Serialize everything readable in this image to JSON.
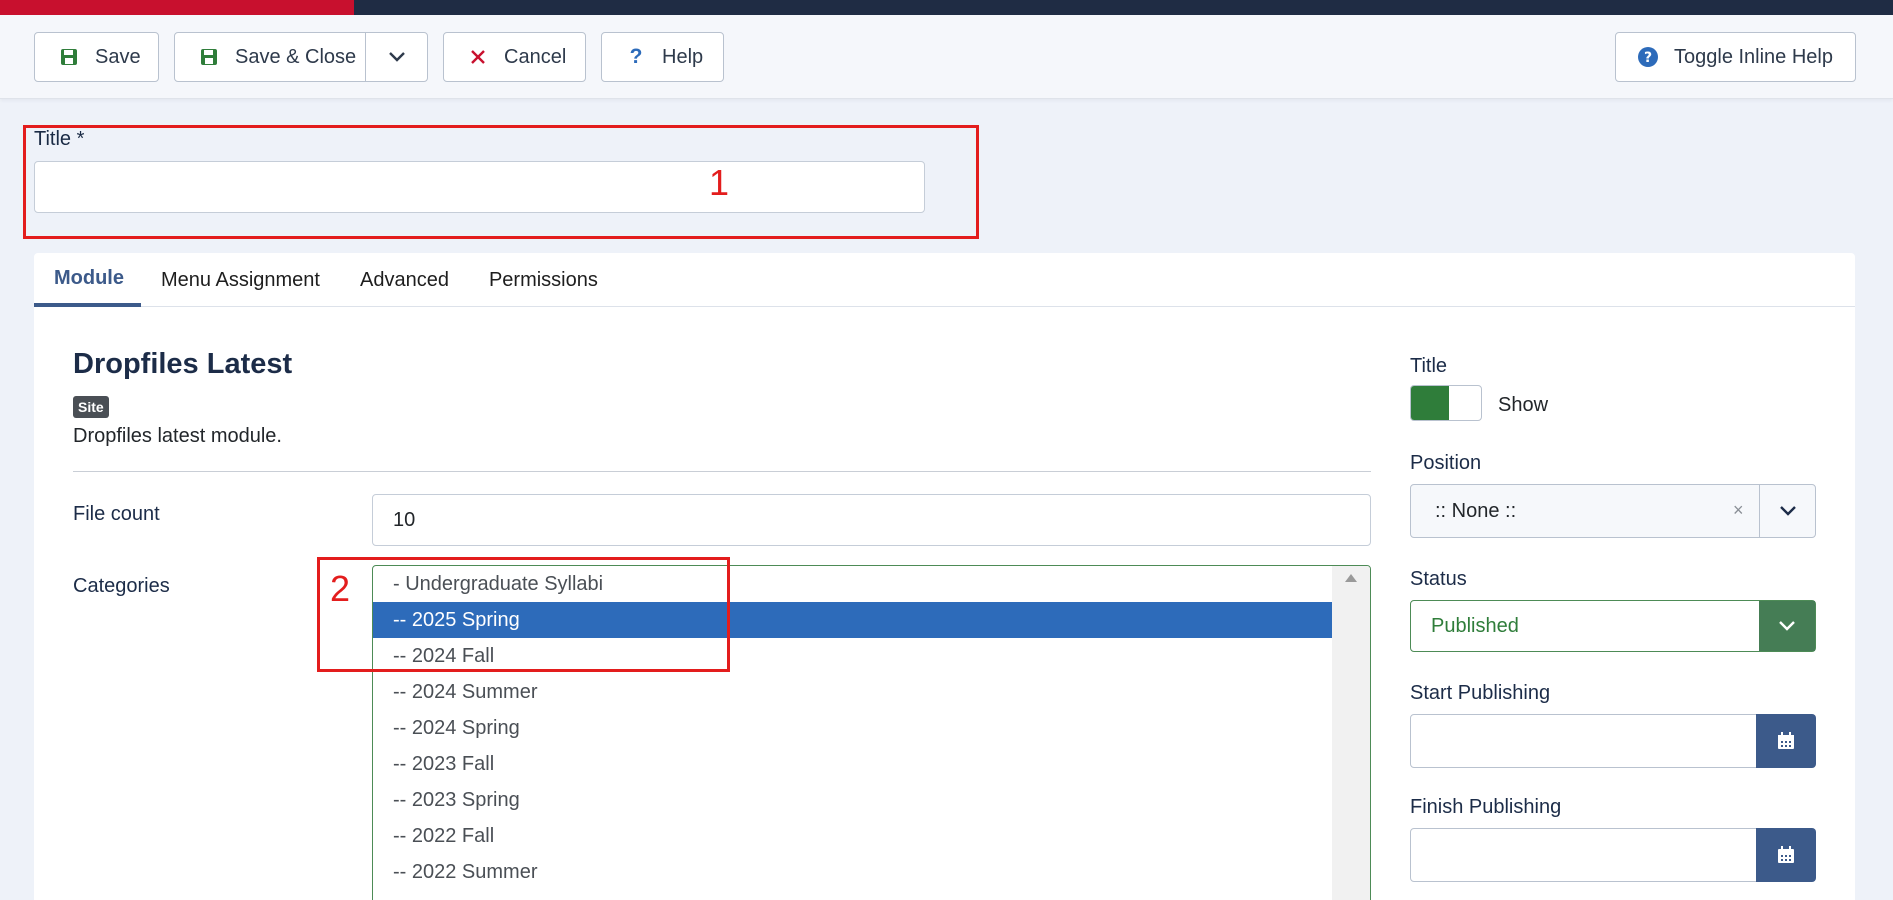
{
  "toolbar": {
    "save_label": "Save",
    "save_close_label": "Save & Close",
    "cancel_label": "Cancel",
    "help_label": "Help",
    "toggle_help_label": "Toggle Inline Help"
  },
  "title_field": {
    "label": "Title *",
    "value": ""
  },
  "annotations": [
    "1",
    "2"
  ],
  "tabs": [
    "Module",
    "Menu Assignment",
    "Advanced",
    "Permissions"
  ],
  "module": {
    "name": "Dropfiles Latest",
    "badge": "Site",
    "description": "Dropfiles latest module."
  },
  "fields": {
    "file_count_label": "File count",
    "file_count_value": "10",
    "categories_label": "Categories",
    "categories": [
      "- Undergraduate Syllabi",
      "-- 2025 Spring",
      "-- 2024 Fall",
      "-- 2024 Summer",
      "-- 2024 Spring",
      "-- 2023 Fall",
      "-- 2023 Spring",
      "-- 2022 Fall",
      "-- 2022 Summer"
    ],
    "selected_category": "-- 2025 Spring"
  },
  "sidebar": {
    "title_label": "Title",
    "title_toggle_text": "Show",
    "position_label": "Position",
    "position_value": ":: None ::",
    "status_label": "Status",
    "status_value": "Published",
    "start_publishing_label": "Start Publishing",
    "finish_publishing_label": "Finish Publishing"
  },
  "colors": {
    "top_accent": "#c8102e",
    "top_bar": "#1f2c44",
    "selected_option": "#2d6bba",
    "toggle_on": "#2f7d3a",
    "status_green": "#457d55",
    "calendar_button": "#3c5a8a",
    "annotation": "#e31d1d"
  },
  "icons": {
    "save": "save-icon",
    "cancel": "close-icon",
    "help": "question-icon",
    "calendar": "calendar-icon",
    "dropdown": "chevron-down-icon"
  }
}
